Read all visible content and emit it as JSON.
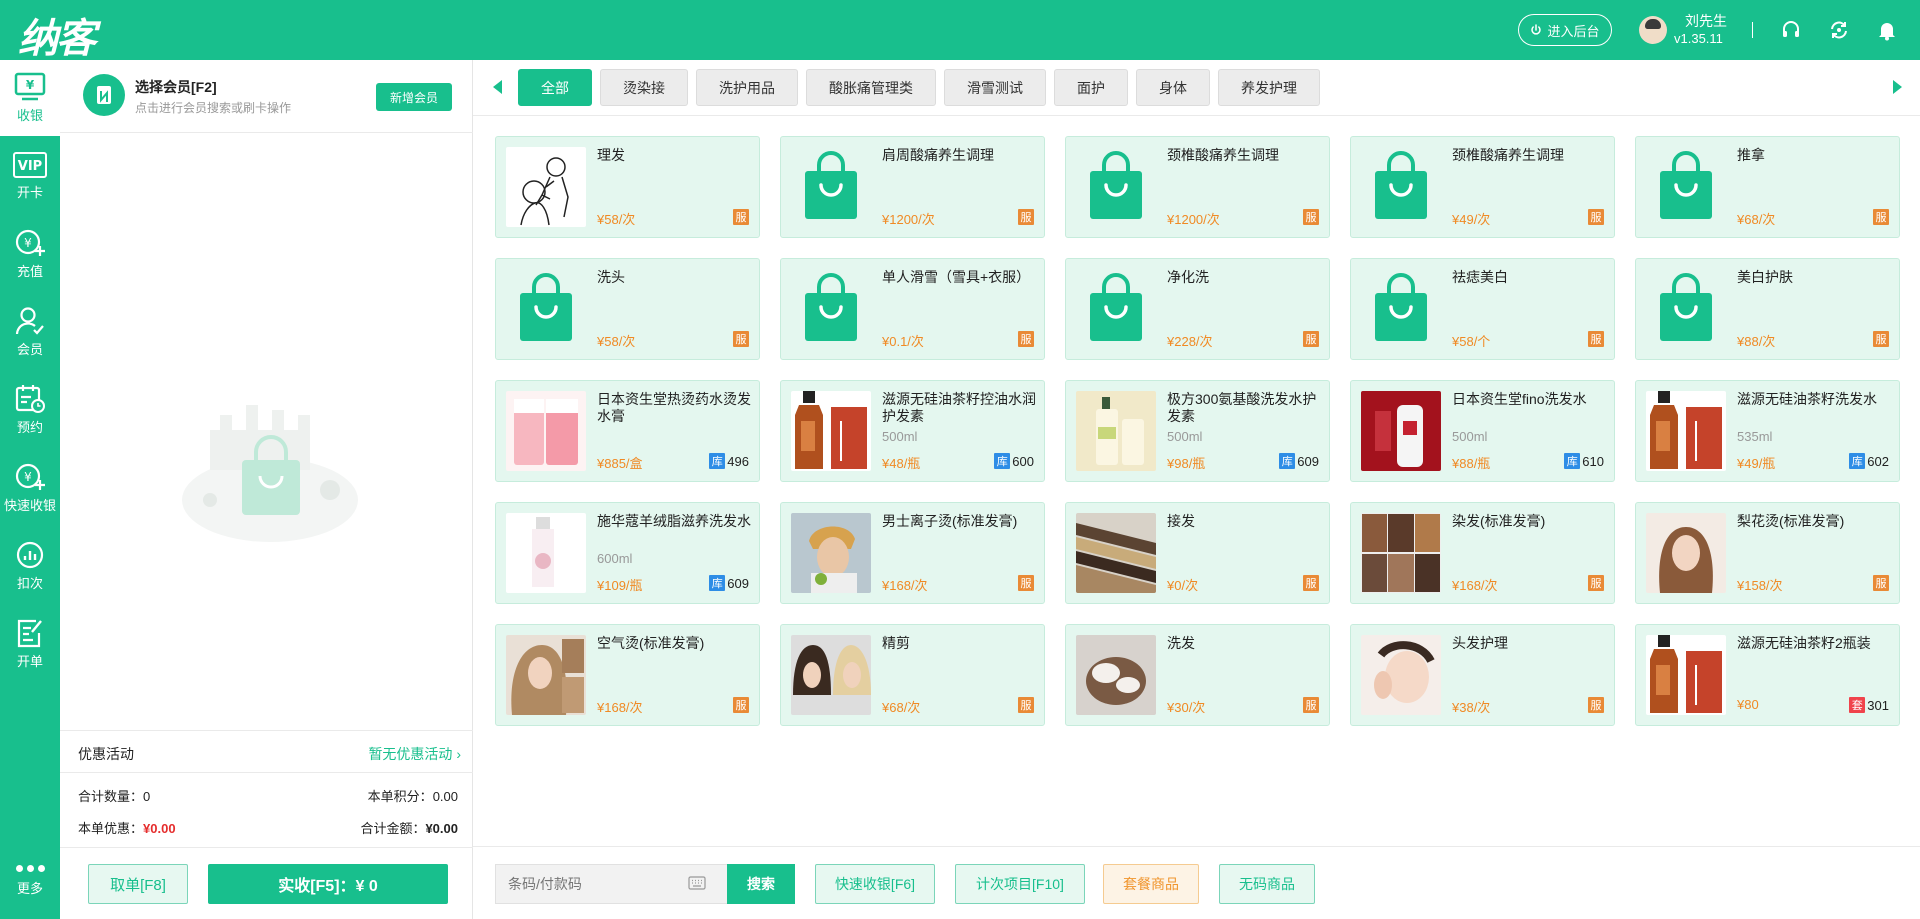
{
  "header": {
    "logo": "纳客",
    "backend_label": "进入后台",
    "user_name": "刘先生",
    "version": "v1.35.11"
  },
  "sidebar": {
    "items": [
      {
        "label": "收银",
        "icon": "cashier-icon"
      },
      {
        "label": "开卡",
        "icon": "vip-card-icon"
      },
      {
        "label": "充值",
        "icon": "recharge-icon"
      },
      {
        "label": "会员",
        "icon": "member-icon"
      },
      {
        "label": "预约",
        "icon": "appointment-icon"
      },
      {
        "label": "快速收银",
        "icon": "quick-cashier-icon"
      },
      {
        "label": "扣次",
        "icon": "deduct-icon"
      },
      {
        "label": "开单",
        "icon": "order-icon"
      }
    ],
    "more_label": "更多"
  },
  "member": {
    "title": "选择会员[F2]",
    "subtitle": "点击进行会员搜索或刷卡操作",
    "new_member_label": "新增会员"
  },
  "promo": {
    "label": "优惠活动",
    "value": "暂无优惠活动"
  },
  "summary": {
    "count_label": "合计数量：",
    "count_value": "0",
    "points_label": "本单积分：",
    "points_value": "0.00",
    "discount_label": "本单优惠：",
    "discount_value": "¥0.00",
    "total_label": "合计金额：",
    "total_value": "¥0.00"
  },
  "footer": {
    "cancel_label": "取单[F8]",
    "pay_label": "实收[F5]：¥ 0"
  },
  "categories": [
    "全部",
    "烫染接",
    "洗护用品",
    "酸胀痛管理类",
    "滑雪测试",
    "面护",
    "身体",
    "养发护理"
  ],
  "products": [
    {
      "name": "理发",
      "spec": "",
      "price": "¥58/次",
      "badge": "服",
      "stock": "",
      "thumb": "haircut"
    },
    {
      "name": "肩周酸痛养生调理",
      "spec": "",
      "price": "¥1200/次",
      "badge": "服",
      "stock": "",
      "thumb": "bag"
    },
    {
      "name": "颈椎酸痛养生调理",
      "spec": "",
      "price": "¥1200/次",
      "badge": "服",
      "stock": "",
      "thumb": "bag"
    },
    {
      "name": "颈椎酸痛养生调理",
      "spec": "",
      "price": "¥49/次",
      "badge": "服",
      "stock": "",
      "thumb": "bag"
    },
    {
      "name": "推拿",
      "spec": "",
      "price": "¥68/次",
      "badge": "服",
      "stock": "",
      "thumb": "bag"
    },
    {
      "name": "洗头",
      "spec": "",
      "price": "¥58/次",
      "badge": "服",
      "stock": "",
      "thumb": "bag"
    },
    {
      "name": "单人滑雪（雪具+衣服）",
      "spec": "",
      "price": "¥0.1/次",
      "badge": "服",
      "stock": "",
      "thumb": "bag"
    },
    {
      "name": "净化洗",
      "spec": "",
      "price": "¥228/次",
      "badge": "服",
      "stock": "",
      "thumb": "bag"
    },
    {
      "name": "祛痣美白",
      "spec": "",
      "price": "¥58/个",
      "badge": "服",
      "stock": "",
      "thumb": "bag"
    },
    {
      "name": "美白护肤",
      "spec": "",
      "price": "¥88/次",
      "badge": "服",
      "stock": "",
      "thumb": "bag"
    },
    {
      "name": "日本资生堂热烫药水烫发水膏",
      "spec": "",
      "price": "¥885/盒",
      "badge": "库",
      "stock": "496",
      "thumb": "pouch"
    },
    {
      "name": "滋源无硅油茶籽控油水润护发素",
      "spec": "500ml",
      "price": "¥48/瓶",
      "badge": "库",
      "stock": "600",
      "thumb": "amber-bottle"
    },
    {
      "name": "极方300氨基酸洗发水护发素",
      "spec": "500ml",
      "price": "¥98/瓶",
      "badge": "库",
      "stock": "609",
      "thumb": "cream-bottle"
    },
    {
      "name": "日本资生堂fino洗发水",
      "spec": "500ml",
      "price": "¥88/瓶",
      "badge": "库",
      "stock": "610",
      "thumb": "red-box"
    },
    {
      "name": "滋源无硅油茶籽洗发水",
      "spec": "535ml",
      "price": "¥49/瓶",
      "badge": "库",
      "stock": "602",
      "thumb": "amber-bottle"
    },
    {
      "name": "施华蔻羊绒脂滋养洗发水",
      "spec": "600ml",
      "price": "¥109/瓶",
      "badge": "库",
      "stock": "609",
      "thumb": "white-bottle"
    },
    {
      "name": "男士离子烫(标准发膏)",
      "spec": "",
      "price": "¥168/次",
      "badge": "服",
      "stock": "",
      "thumb": "photo-man"
    },
    {
      "name": "接发",
      "spec": "",
      "price": "¥0/次",
      "badge": "服",
      "stock": "",
      "thumb": "photo-extension"
    },
    {
      "name": "染发(标准发膏)",
      "spec": "",
      "price": "¥168/次",
      "badge": "服",
      "stock": "",
      "thumb": "photo-grid"
    },
    {
      "name": "梨花烫(标准发膏)",
      "spec": "",
      "price": "¥158/次",
      "badge": "服",
      "stock": "",
      "thumb": "photo-woman"
    },
    {
      "name": "空气烫(标准发膏)",
      "spec": "",
      "price": "¥168/次",
      "badge": "服",
      "stock": "",
      "thumb": "photo-curly"
    },
    {
      "name": "精剪",
      "spec": "",
      "price": "¥68/次",
      "badge": "服",
      "stock": "",
      "thumb": "photo-bob"
    },
    {
      "name": "洗发",
      "spec": "",
      "price": "¥30/次",
      "badge": "服",
      "stock": "",
      "thumb": "photo-wash"
    },
    {
      "name": "头发护理",
      "spec": "",
      "price": "¥38/次",
      "badge": "服",
      "stock": "",
      "thumb": "photo-face"
    },
    {
      "name": "滋源无硅油茶籽2瓶装",
      "spec": "",
      "price": "¥80",
      "badge": "套",
      "stock": "301",
      "thumb": "amber-bottle"
    }
  ],
  "search": {
    "placeholder": "条码/付款码",
    "button_label": "搜索"
  },
  "actions": [
    "快速收银[F6]",
    "计次项目[F10]",
    "套餐商品",
    "无码商品"
  ],
  "colors": {
    "brand": "#18bf8d",
    "price": "#f08a24",
    "service_badge": "#e98a36",
    "stock_badge": "#2e8de6",
    "package_badge": "#f0434b",
    "discount": "#e52d2d"
  }
}
